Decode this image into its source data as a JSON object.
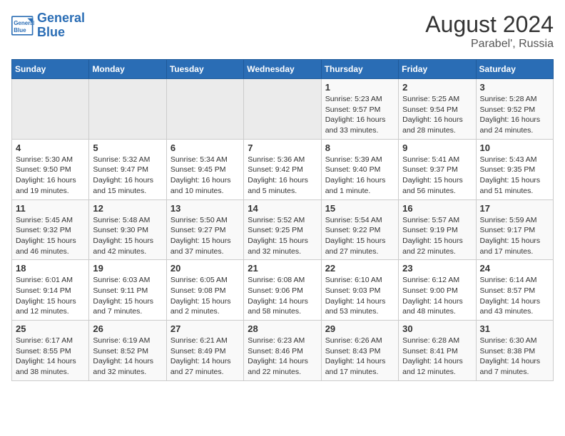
{
  "header": {
    "logo_line1": "General",
    "logo_line2": "Blue",
    "title": "August 2024",
    "subtitle": "Parabel', Russia"
  },
  "days_of_week": [
    "Sunday",
    "Monday",
    "Tuesday",
    "Wednesday",
    "Thursday",
    "Friday",
    "Saturday"
  ],
  "weeks": [
    [
      {
        "date": "",
        "info": ""
      },
      {
        "date": "",
        "info": ""
      },
      {
        "date": "",
        "info": ""
      },
      {
        "date": "",
        "info": ""
      },
      {
        "date": "1",
        "info": "Sunrise: 5:23 AM\nSunset: 9:57 PM\nDaylight: 16 hours\nand 33 minutes."
      },
      {
        "date": "2",
        "info": "Sunrise: 5:25 AM\nSunset: 9:54 PM\nDaylight: 16 hours\nand 28 minutes."
      },
      {
        "date": "3",
        "info": "Sunrise: 5:28 AM\nSunset: 9:52 PM\nDaylight: 16 hours\nand 24 minutes."
      }
    ],
    [
      {
        "date": "4",
        "info": "Sunrise: 5:30 AM\nSunset: 9:50 PM\nDaylight: 16 hours\nand 19 minutes."
      },
      {
        "date": "5",
        "info": "Sunrise: 5:32 AM\nSunset: 9:47 PM\nDaylight: 16 hours\nand 15 minutes."
      },
      {
        "date": "6",
        "info": "Sunrise: 5:34 AM\nSunset: 9:45 PM\nDaylight: 16 hours\nand 10 minutes."
      },
      {
        "date": "7",
        "info": "Sunrise: 5:36 AM\nSunset: 9:42 PM\nDaylight: 16 hours\nand 5 minutes."
      },
      {
        "date": "8",
        "info": "Sunrise: 5:39 AM\nSunset: 9:40 PM\nDaylight: 16 hours\nand 1 minute."
      },
      {
        "date": "9",
        "info": "Sunrise: 5:41 AM\nSunset: 9:37 PM\nDaylight: 15 hours\nand 56 minutes."
      },
      {
        "date": "10",
        "info": "Sunrise: 5:43 AM\nSunset: 9:35 PM\nDaylight: 15 hours\nand 51 minutes."
      }
    ],
    [
      {
        "date": "11",
        "info": "Sunrise: 5:45 AM\nSunset: 9:32 PM\nDaylight: 15 hours\nand 46 minutes."
      },
      {
        "date": "12",
        "info": "Sunrise: 5:48 AM\nSunset: 9:30 PM\nDaylight: 15 hours\nand 42 minutes."
      },
      {
        "date": "13",
        "info": "Sunrise: 5:50 AM\nSunset: 9:27 PM\nDaylight: 15 hours\nand 37 minutes."
      },
      {
        "date": "14",
        "info": "Sunrise: 5:52 AM\nSunset: 9:25 PM\nDaylight: 15 hours\nand 32 minutes."
      },
      {
        "date": "15",
        "info": "Sunrise: 5:54 AM\nSunset: 9:22 PM\nDaylight: 15 hours\nand 27 minutes."
      },
      {
        "date": "16",
        "info": "Sunrise: 5:57 AM\nSunset: 9:19 PM\nDaylight: 15 hours\nand 22 minutes."
      },
      {
        "date": "17",
        "info": "Sunrise: 5:59 AM\nSunset: 9:17 PM\nDaylight: 15 hours\nand 17 minutes."
      }
    ],
    [
      {
        "date": "18",
        "info": "Sunrise: 6:01 AM\nSunset: 9:14 PM\nDaylight: 15 hours\nand 12 minutes."
      },
      {
        "date": "19",
        "info": "Sunrise: 6:03 AM\nSunset: 9:11 PM\nDaylight: 15 hours\nand 7 minutes."
      },
      {
        "date": "20",
        "info": "Sunrise: 6:05 AM\nSunset: 9:08 PM\nDaylight: 15 hours\nand 2 minutes."
      },
      {
        "date": "21",
        "info": "Sunrise: 6:08 AM\nSunset: 9:06 PM\nDaylight: 14 hours\nand 58 minutes."
      },
      {
        "date": "22",
        "info": "Sunrise: 6:10 AM\nSunset: 9:03 PM\nDaylight: 14 hours\nand 53 minutes."
      },
      {
        "date": "23",
        "info": "Sunrise: 6:12 AM\nSunset: 9:00 PM\nDaylight: 14 hours\nand 48 minutes."
      },
      {
        "date": "24",
        "info": "Sunrise: 6:14 AM\nSunset: 8:57 PM\nDaylight: 14 hours\nand 43 minutes."
      }
    ],
    [
      {
        "date": "25",
        "info": "Sunrise: 6:17 AM\nSunset: 8:55 PM\nDaylight: 14 hours\nand 38 minutes."
      },
      {
        "date": "26",
        "info": "Sunrise: 6:19 AM\nSunset: 8:52 PM\nDaylight: 14 hours\nand 32 minutes."
      },
      {
        "date": "27",
        "info": "Sunrise: 6:21 AM\nSunset: 8:49 PM\nDaylight: 14 hours\nand 27 minutes."
      },
      {
        "date": "28",
        "info": "Sunrise: 6:23 AM\nSunset: 8:46 PM\nDaylight: 14 hours\nand 22 minutes."
      },
      {
        "date": "29",
        "info": "Sunrise: 6:26 AM\nSunset: 8:43 PM\nDaylight: 14 hours\nand 17 minutes."
      },
      {
        "date": "30",
        "info": "Sunrise: 6:28 AM\nSunset: 8:41 PM\nDaylight: 14 hours\nand 12 minutes."
      },
      {
        "date": "31",
        "info": "Sunrise: 6:30 AM\nSunset: 8:38 PM\nDaylight: 14 hours\nand 7 minutes."
      }
    ]
  ]
}
